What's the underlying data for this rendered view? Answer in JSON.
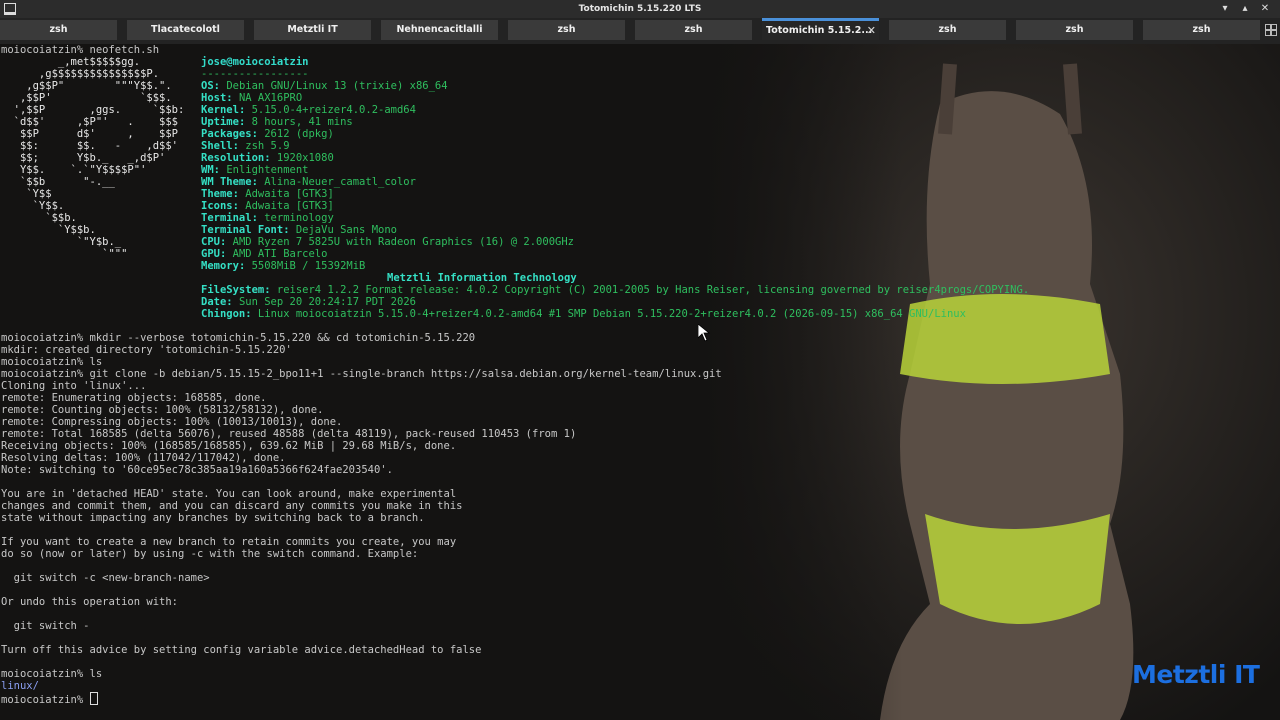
{
  "window": {
    "title": "Totomichin 5.15.220 LTS"
  },
  "tabs": [
    {
      "label": "zsh",
      "active": false
    },
    {
      "label": "Tlacatecolotl",
      "active": false
    },
    {
      "label": "Metztli IT",
      "active": false
    },
    {
      "label": "Nehnencacitlalli",
      "active": false
    },
    {
      "label": "zsh",
      "active": false
    },
    {
      "label": "zsh",
      "active": false
    },
    {
      "label": "Totomichin 5.15.2...",
      "active": true
    },
    {
      "label": "zsh",
      "active": false
    },
    {
      "label": "zsh",
      "active": false
    },
    {
      "label": "zsh",
      "active": false
    }
  ],
  "terminal": {
    "neofetch_cmd": "moiocoiatzin% neofetch.sh",
    "art": [
      "         _,met$$$$$gg.",
      "      ,g$$$$$$$$$$$$$$$P.",
      "    ,g$$P\"        \"\"\"Y$$.\".",
      "   ,$$P'              `$$$.",
      "  ',$$P       ,ggs.     `$$b:",
      "  `d$$'     ,$P\"'   .    $$$",
      "   $$P      d$'     ,    $$P",
      "   $$:      $$.   -    ,d$$'",
      "   $$;      Y$b._   _,d$P'",
      "   Y$$.    `.`\"Y$$$$P\"'",
      "   `$$b      \"-.__",
      "    `Y$$",
      "     `Y$$.",
      "       `$$b.",
      "         `Y$$b.",
      "            `\"Y$b._",
      "                `\"\"\""
    ],
    "user_host": "jose@moiocoiatzin",
    "separator": "-----------------",
    "info": [
      {
        "label": "OS",
        "value": "Debian GNU/Linux 13 (trixie) x86_64"
      },
      {
        "label": "Host",
        "value": "NA AX16PRO"
      },
      {
        "label": "Kernel",
        "value": "5.15.0-4+reizer4.0.2-amd64"
      },
      {
        "label": "Uptime",
        "value": "8 hours, 41 mins"
      },
      {
        "label": "Packages",
        "value": "2612 (dpkg)"
      },
      {
        "label": "Shell",
        "value": "zsh 5.9"
      },
      {
        "label": "Resolution",
        "value": "1920x1080"
      },
      {
        "label": "WM",
        "value": "Enlightenment"
      },
      {
        "label": "WM Theme",
        "value": "Alina-Neuer_camatl_color"
      },
      {
        "label": "Theme",
        "value": "Adwaita [GTK3]"
      },
      {
        "label": "Icons",
        "value": "Adwaita [GTK3]"
      },
      {
        "label": "Terminal",
        "value": "terminology"
      },
      {
        "label": "Terminal Font",
        "value": "DejaVu Sans Mono"
      },
      {
        "label": "CPU",
        "value": "AMD Ryzen 7 5825U with Radeon Graphics (16) @ 2.000GHz"
      },
      {
        "label": "GPU",
        "value": "AMD ATI Barcelo"
      },
      {
        "label": "Memory",
        "value": "5508MiB / 15392MiB"
      }
    ],
    "org": "Metztli Information Technology",
    "info2": [
      {
        "label": "FileSystem",
        "value": "reiser4 1.2.2 Format release: 4.0.2 Copyright (C) 2001-2005 by Hans Reiser, licensing governed by reiser4progs/COPYING."
      },
      {
        "label": "Date",
        "value": "Sun Sep 20 20:24:17 PDT 2026"
      },
      {
        "label": "Chingon",
        "value": "Linux moiocoiatzin 5.15.0-4+reizer4.0.2-amd64 #1 SMP Debian 5.15.220-2+reizer4.0.2 (2026-09-15) x86_64 GNU/Linux"
      }
    ],
    "output": [
      "moiocoiatzin% mkdir --verbose totomichin-5.15.220 && cd totomichin-5.15.220",
      "mkdir: created directory 'totomichin-5.15.220'",
      "moiocoiatzin% ls",
      "moiocoiatzin% git clone -b debian/5.15.15-2_bpo11+1 --single-branch https://salsa.debian.org/kernel-team/linux.git",
      "Cloning into 'linux'...",
      "remote: Enumerating objects: 168585, done.",
      "remote: Counting objects: 100% (58132/58132), done.",
      "remote: Compressing objects: 100% (10013/10013), done.",
      "remote: Total 168585 (delta 56076), reused 48588 (delta 48119), pack-reused 110453 (from 1)",
      "Receiving objects: 100% (168585/168585), 639.62 MiB | 29.68 MiB/s, done.",
      "Resolving deltas: 100% (117042/117042), done.",
      "Note: switching to '60ce95ec78c385aa19a160a5366f624fae203540'.",
      "",
      "You are in 'detached HEAD' state. You can look around, make experimental",
      "changes and commit them, and you can discard any commits you make in this",
      "state without impacting any branches by switching back to a branch.",
      "",
      "If you want to create a new branch to retain commits you create, you may",
      "do so (now or later) by using -c with the switch command. Example:",
      "",
      "  git switch -c <new-branch-name>",
      "",
      "Or undo this operation with:",
      "",
      "  git switch -",
      "",
      "Turn off this advice by setting config variable advice.detachedHead to false",
      "",
      "moiocoiatzin% ls"
    ],
    "ls_result": "linux/",
    "prompt": "moiocoiatzin% "
  },
  "watermark": "Metztli IT",
  "colors": {
    "accent": "#4a90d9",
    "label": "#35e0c5",
    "value": "#2fbf5f",
    "watermark": "#1c6fe0"
  }
}
